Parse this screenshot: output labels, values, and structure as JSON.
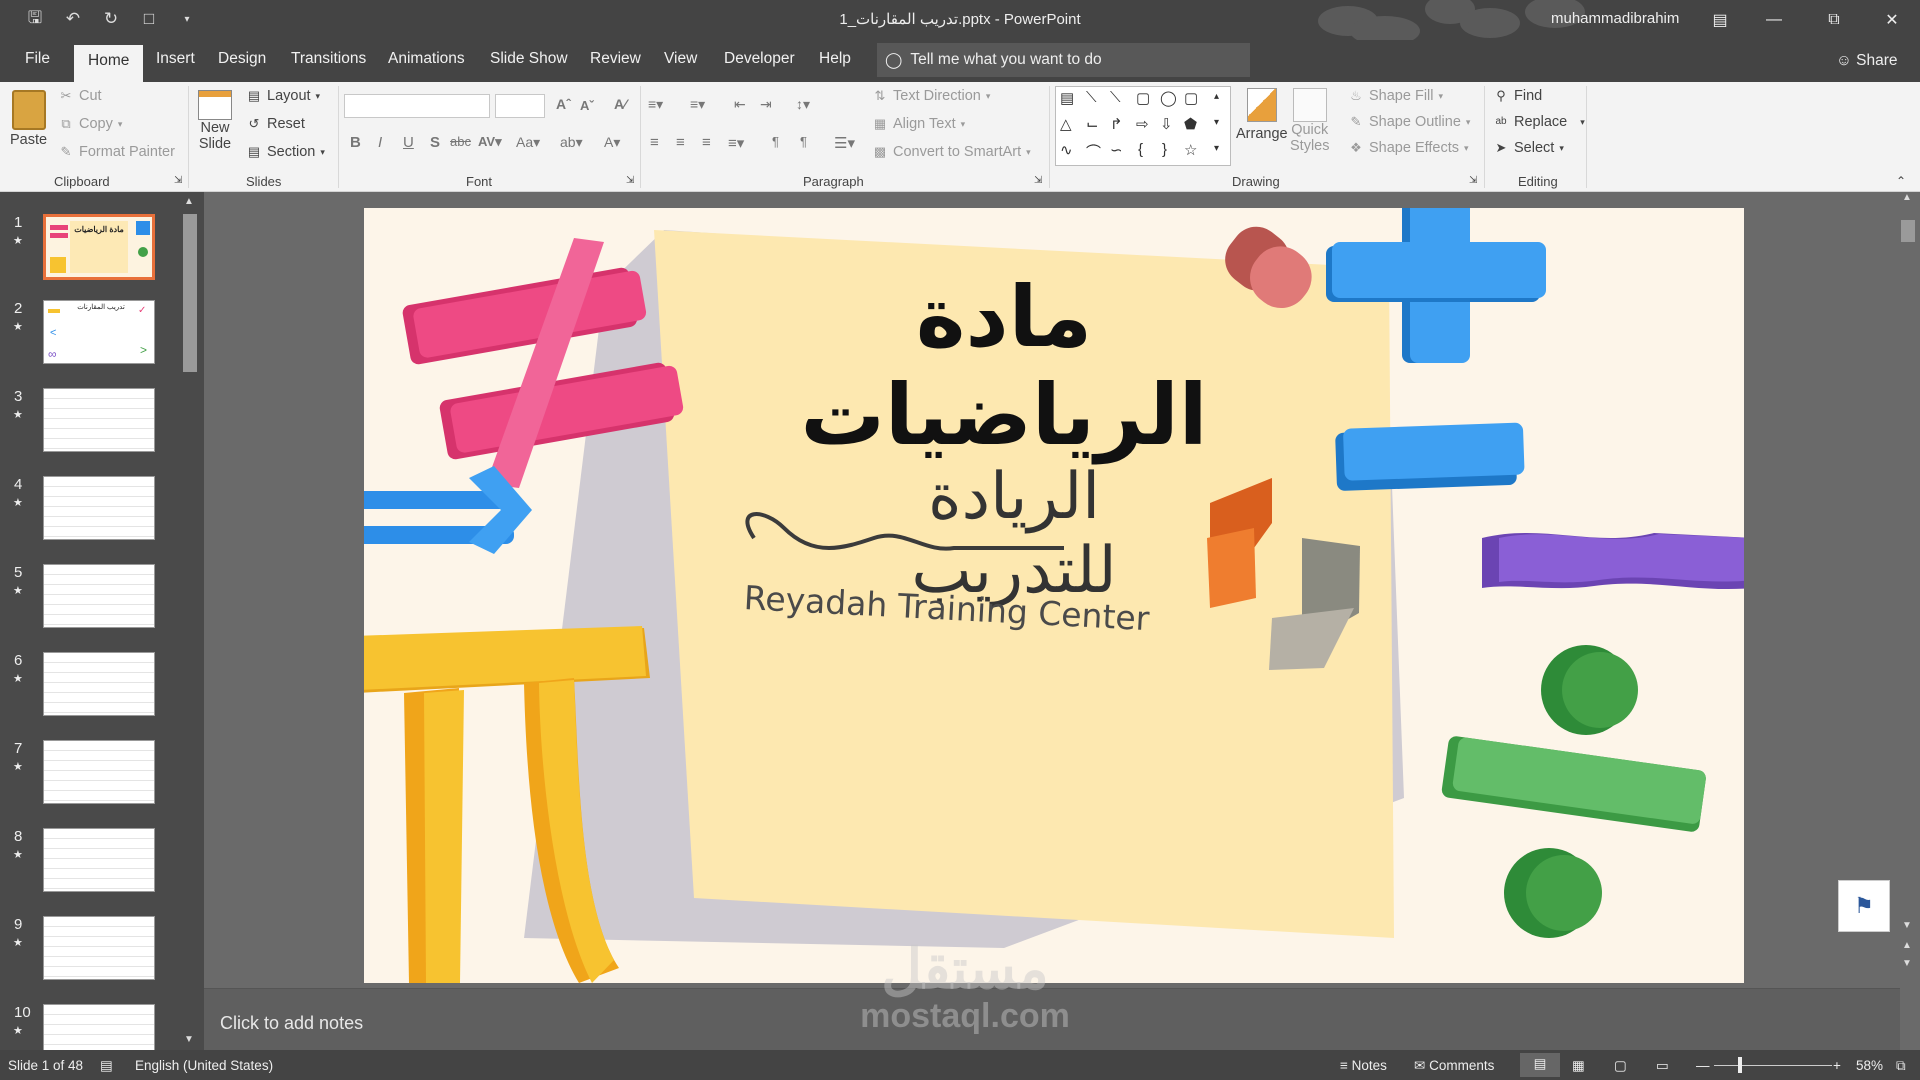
{
  "window": {
    "title": "تدريب المقارنات_1.pptx  -  PowerPoint",
    "user": "muhammadibrahim"
  },
  "tabs": [
    "File",
    "Home",
    "Insert",
    "Design",
    "Transitions",
    "Animations",
    "Slide Show",
    "Review",
    "View",
    "Developer",
    "Help"
  ],
  "active_tab": "Home",
  "tell_me": "Tell me what you want to do",
  "share": "Share",
  "ribbon": {
    "clipboard": {
      "label": "Clipboard",
      "paste": "Paste",
      "cut": "Cut",
      "copy": "Copy",
      "format_painter": "Format Painter"
    },
    "slides": {
      "label": "Slides",
      "new_slide_1": "New",
      "new_slide_2": "Slide",
      "layout": "Layout",
      "reset": "Reset",
      "section": "Section"
    },
    "font": {
      "label": "Font"
    },
    "paragraph": {
      "label": "Paragraph",
      "text_direction": "Text Direction",
      "align_text": "Align Text",
      "convert_smartart": "Convert to SmartArt"
    },
    "drawing": {
      "label": "Drawing",
      "arrange": "Arrange",
      "quick_styles_1": "Quick",
      "quick_styles_2": "Styles",
      "shape_fill": "Shape Fill",
      "shape_outline": "Shape Outline",
      "shape_effects": "Shape Effects"
    },
    "editing": {
      "label": "Editing",
      "find": "Find",
      "replace": "Replace",
      "select": "Select"
    }
  },
  "slides_pane": [
    {
      "num": "1",
      "selected": true
    },
    {
      "num": "2"
    },
    {
      "num": "3"
    },
    {
      "num": "4"
    },
    {
      "num": "5"
    },
    {
      "num": "6"
    },
    {
      "num": "7"
    },
    {
      "num": "8"
    },
    {
      "num": "9"
    },
    {
      "num": "10"
    }
  ],
  "thumb_text": {
    "slide1": "مادة الرياضيات",
    "slide2": "تدريب المقارنات"
  },
  "slide": {
    "title": "مادة الرياضيات",
    "logo_arabic": "الريادة للتدريب",
    "logo_english": "Reyadah Training Center"
  },
  "notes_placeholder": "Click to add notes",
  "status": {
    "slide_info": "Slide 1 of 48",
    "language": "English (United States)",
    "notes": "Notes",
    "comments": "Comments",
    "zoom": "58%"
  },
  "watermark": {
    "arabic": "مستقل",
    "latin": "mostaql.com"
  },
  "colors": {
    "accent": "#c43e1c",
    "pink": "#e8437a",
    "blue": "#2d8ee8",
    "yellow": "#f7c330",
    "green": "#43a047",
    "purple": "#7e55c8",
    "logo_orange": "#ef7d2f"
  }
}
